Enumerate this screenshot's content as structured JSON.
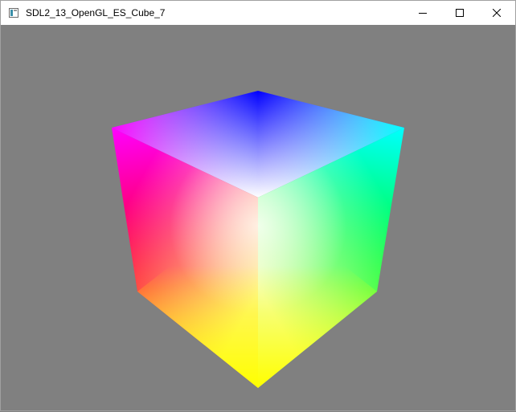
{
  "window": {
    "title": "SDL2_13_OpenGL_ES_Cube_7",
    "icon": "app-window-icon",
    "controls": {
      "minimize": "minimize-icon",
      "maximize": "maximize-icon",
      "close": "close-icon"
    }
  },
  "scene": {
    "background_color": "#808080",
    "object": "rgb-color-cube",
    "vertex_colors": {
      "top_back": "#0000ff",
      "top_left": "#ff00ff",
      "top_right": "#00ffff",
      "top_front": "#ffffff",
      "bottom_left": "#ff0000",
      "bottom_right": "#00ff00",
      "bottom_front": "#ffff00"
    }
  }
}
